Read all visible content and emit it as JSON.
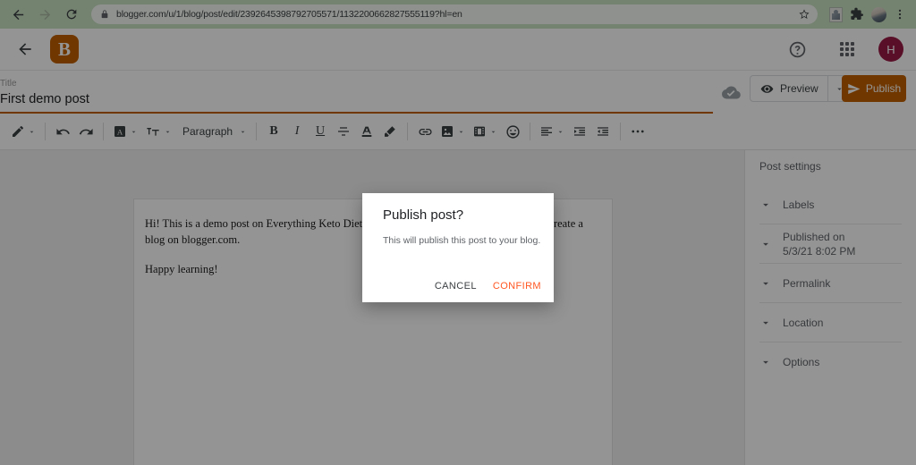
{
  "browser": {
    "url": "blogger.com/u/1/blog/post/edit/2392645398792705571/1132200662827555119?hl=en",
    "back_icon": "arrow-left-icon",
    "forward_icon": "arrow-right-icon",
    "reload_icon": "reload-icon",
    "lock_icon": "lock-icon",
    "bookmark_icon": "star-icon",
    "extension_icon": "extension-icon",
    "puzzle_icon": "puzzle-piece-icon",
    "profile_icon": "profile-avatar-icon",
    "menu_icon": "three-dot-menu-icon",
    "chrome_bg": "#c9e0c2"
  },
  "app": {
    "back_icon": "arrow-back-icon",
    "logo_icon": "blogger-logo-icon",
    "logo_glyph": "B",
    "logo_color": "#c26100",
    "help_icon": "help-circle-icon",
    "apps_icon": "apps-grid-icon",
    "avatar_initial": "H",
    "avatar_color": "#9c1b47"
  },
  "title_row": {
    "label": "Title",
    "value": "First demo post",
    "underline_color": "#c26100",
    "save_icon": "cloud-done-icon",
    "preview_label": "Preview",
    "preview_icon": "eye-icon",
    "preview_caret_icon": "chevron-down-icon",
    "publish_label": "Publish",
    "publish_icon": "send-icon",
    "publish_color": "#c26100"
  },
  "toolbar": {
    "items": [
      {
        "name": "pen-tool",
        "icon": "pencil-icon",
        "caret": true
      },
      {
        "name": "separator-1",
        "icon": "separator",
        "caret": false
      },
      {
        "name": "undo",
        "icon": "undo-icon",
        "caret": false
      },
      {
        "name": "redo",
        "icon": "redo-icon",
        "caret": false
      },
      {
        "name": "separator-2",
        "icon": "separator",
        "caret": false
      },
      {
        "name": "font-family",
        "icon": "font-box-icon",
        "caret": true
      },
      {
        "name": "font-size",
        "icon": "text-size-icon",
        "caret": true
      },
      {
        "name": "paragraph-style",
        "icon": "text-label",
        "label": "Paragraph",
        "caret": true
      },
      {
        "name": "separator-3",
        "icon": "separator",
        "caret": false
      },
      {
        "name": "bold",
        "icon": "bold-icon",
        "caret": false
      },
      {
        "name": "italic",
        "icon": "italic-icon",
        "caret": false
      },
      {
        "name": "underline",
        "icon": "underline-icon",
        "caret": false
      },
      {
        "name": "strikethrough",
        "icon": "strikethrough-icon",
        "caret": false
      },
      {
        "name": "text-color",
        "icon": "text-color-icon",
        "caret": false
      },
      {
        "name": "highlight-color",
        "icon": "marker-pen-icon",
        "caret": false
      },
      {
        "name": "separator-4",
        "icon": "separator",
        "caret": false
      },
      {
        "name": "insert-link",
        "icon": "link-icon",
        "caret": false
      },
      {
        "name": "insert-image",
        "icon": "image-icon",
        "caret": true
      },
      {
        "name": "insert-video",
        "icon": "video-icon",
        "caret": true
      },
      {
        "name": "insert-emoji",
        "icon": "emoji-icon",
        "caret": false
      },
      {
        "name": "separator-5",
        "icon": "separator",
        "caret": false
      },
      {
        "name": "align",
        "icon": "align-left-icon",
        "caret": true
      },
      {
        "name": "indent-increase",
        "icon": "indent-increase-icon",
        "caret": false
      },
      {
        "name": "indent-decrease",
        "icon": "indent-decrease-icon",
        "caret": false
      },
      {
        "name": "separator-6",
        "icon": "separator",
        "caret": false
      },
      {
        "name": "more-options",
        "icon": "ellipsis-icon",
        "caret": false
      }
    ],
    "paragraph_label": "Paragraph"
  },
  "editor": {
    "paragraphs": [
      "Hi! This is a demo post on Everything Keto Diet. You are currently learning about how to create a blog on blogger.com.",
      "Happy learning!"
    ]
  },
  "post_settings": {
    "title": "Post settings",
    "rows": [
      {
        "label": "Labels",
        "sub": "",
        "icon": "chevron-down-icon"
      },
      {
        "label": "Published on",
        "sub": "5/3/21 8:02 PM",
        "icon": "chevron-down-icon"
      },
      {
        "label": "Permalink",
        "sub": "",
        "icon": "chevron-down-icon"
      },
      {
        "label": "Location",
        "sub": "",
        "icon": "chevron-down-icon"
      },
      {
        "label": "Options",
        "sub": "",
        "icon": "chevron-down-icon"
      }
    ]
  },
  "dialog": {
    "title": "Publish post?",
    "body": "This will publish this post to your blog.",
    "cancel_label": "CANCEL",
    "confirm_label": "CONFIRM",
    "confirm_color": "#ff5722"
  }
}
